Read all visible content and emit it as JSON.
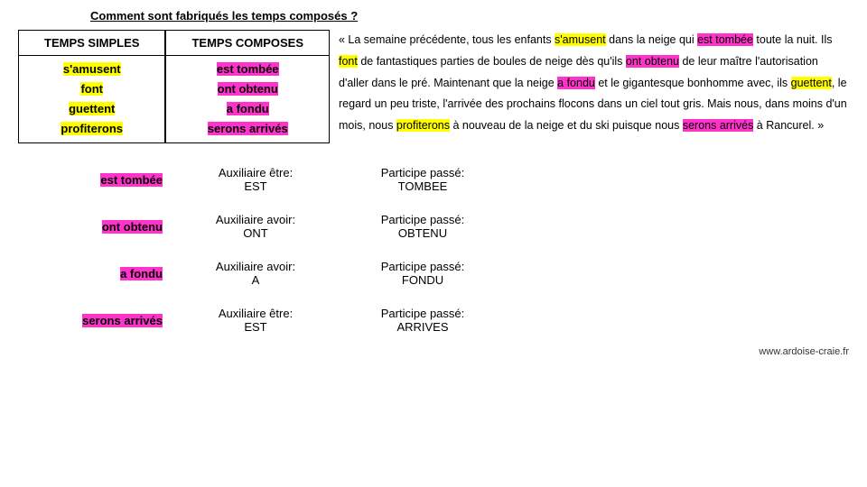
{
  "title": "Comment sont fabriqués les temps composés ?",
  "table": {
    "hSimple": "TEMPS SIMPLES",
    "hCompose": "TEMPS COMPOSES",
    "simples": {
      "r1": "s'amusent",
      "r2": "font",
      "r3": "guettent",
      "r4": "profiterons"
    },
    "composes": {
      "r1": "est tombée",
      "r2": "ont obtenu",
      "r3": "a fondu",
      "r4": "serons arrivés"
    }
  },
  "paragraph": {
    "p0": "« La semaine précédente, tous les enfants ",
    "w0": "s'amusent",
    "p1": " dans la neige qui ",
    "w1": "est tombée",
    "p2": " toute la nuit. Ils ",
    "w2": "font",
    "p3": " de fantastiques parties de boules de neige dès qu'ils ",
    "w3": "ont obtenu",
    "p4": " de leur maître l'autorisation d'aller dans le pré. Maintenant que la neige ",
    "w4": "a fondu",
    "p5": " et le gigantesque bonhomme avec, ils ",
    "w5": "guettent",
    "p6": ", le regard un peu triste, l'arrivée des prochains flocons dans un ciel tout gris. Mais nous, dans moins d'un mois, nous ",
    "w6": "profiterons",
    "p7": " à nouveau de la neige et du ski puisque nous ",
    "w7": "serons arrivés",
    "p8": " à Rancurel. »"
  },
  "rows": [
    {
      "verb": "est tombée",
      "aux1": "Auxiliaire être:",
      "aux2": "EST",
      "pp1": "Participe passé:",
      "pp2": "TOMBEE"
    },
    {
      "verb": "ont obtenu",
      "aux1": "Auxiliaire avoir:",
      "aux2": "ONT",
      "pp1": "Participe passé:",
      "pp2": "OBTENU"
    },
    {
      "verb": "a fondu",
      "aux1": "Auxiliaire avoir:",
      "aux2": "A",
      "pp1": "Participe passé:",
      "pp2": "FONDU"
    },
    {
      "verb": "serons arrivés",
      "aux1": "Auxiliaire être:",
      "aux2": "EST",
      "pp1": "Participe passé:",
      "pp2": "ARRIVES"
    }
  ],
  "footer": "www.ardoise-craie.fr"
}
